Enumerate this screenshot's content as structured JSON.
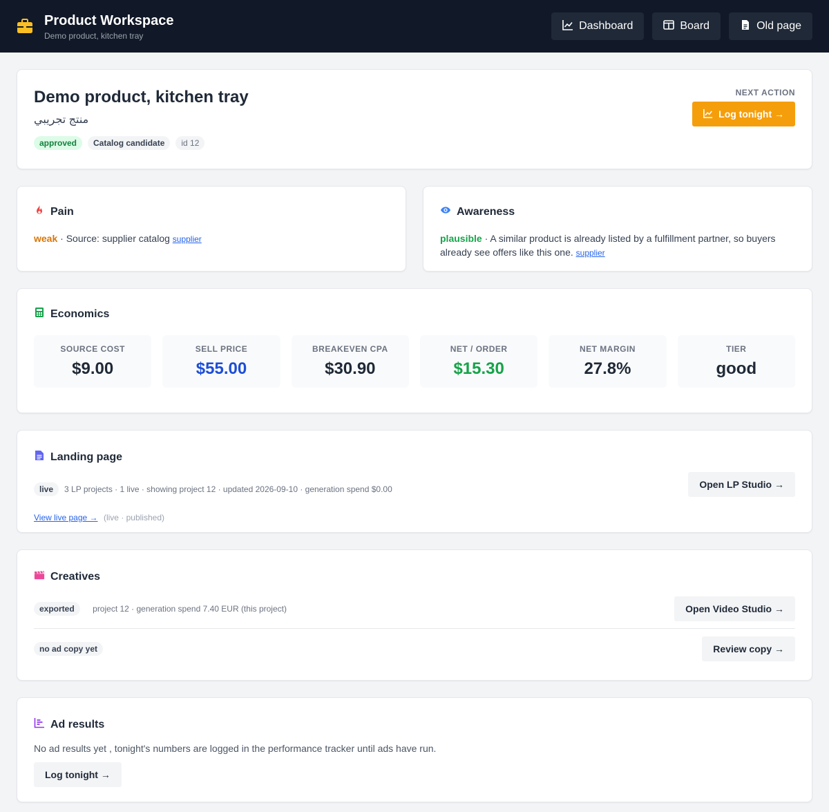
{
  "header": {
    "title": "Product Workspace",
    "subtitle": "Demo product, kitchen tray",
    "nav": [
      {
        "label": "Dashboard",
        "icon": "chart-line-icon"
      },
      {
        "label": "Board",
        "icon": "columns-icon"
      },
      {
        "label": "Old page",
        "icon": "file-icon"
      }
    ]
  },
  "product": {
    "name": "Demo product, kitchen tray",
    "name_ar": "منتج تجريبي",
    "status": "approved",
    "type": "Catalog candidate",
    "id": "id 12",
    "next_action_label": "NEXT ACTION",
    "next_action_button": "Log tonight →"
  },
  "pain": {
    "title": "Pain",
    "level": "weak",
    "text": " · Source: supplier catalog ",
    "link": "supplier"
  },
  "awareness": {
    "title": "Awareness",
    "level": "plausible",
    "text": " · A similar product is already listed by a fulfillment partner, so buyers already see offers like this one. ",
    "link": "supplier"
  },
  "economics": {
    "title": "Economics",
    "metrics": [
      {
        "label": "SOURCE COST",
        "value": "$9.00",
        "color": "#1f2937"
      },
      {
        "label": "SELL PRICE",
        "value": "$55.00",
        "color": "#1d4ed8"
      },
      {
        "label": "BREAKEVEN CPA",
        "value": "$30.90",
        "color": "#1f2937"
      },
      {
        "label": "NET / ORDER",
        "value": "$15.30",
        "color": "#16a34a"
      },
      {
        "label": "NET MARGIN",
        "value": "27.8%",
        "color": "#1f2937"
      },
      {
        "label": "TIER",
        "value": "good",
        "color": "#1f2937"
      }
    ]
  },
  "landing": {
    "title": "Landing page",
    "status": "live",
    "meta": "3 LP projects · 1 live · showing project 12 · updated 2026-09-10 · generation spend $0.00",
    "link": "View live page →",
    "link_meta": "(live · published)",
    "button": "Open LP Studio →"
  },
  "creatives": {
    "title": "Creatives",
    "status": "exported",
    "meta": "project 12 · generation spend 7.40 EUR (this project)",
    "button": "Open Video Studio →",
    "copy_status": "no ad copy yet",
    "copy_button": "Review copy →"
  },
  "ad_results": {
    "title": "Ad results",
    "text": "No ad results yet , tonight's numbers are logged in the performance tracker until ads have run.",
    "button": "Log tonight →"
  }
}
